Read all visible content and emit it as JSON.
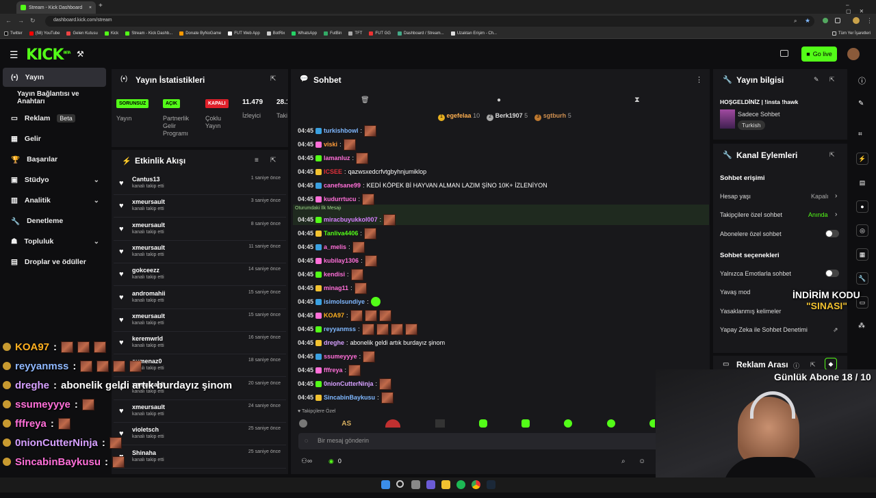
{
  "browser": {
    "tabs": [
      {
        "label": "Stream - Kick Dashboard"
      }
    ],
    "url": "dashboard.kick.com/stream",
    "bookmarks": [
      "Twitter",
      "(58) YouTube",
      "Gelen Kutusu",
      "Kick",
      "Stream - Kick Dashb...",
      "Donate ByNoGame",
      "FUT Web App",
      "BotRix",
      "WhatsApp",
      "FutBin",
      "TFT",
      "FUT GG",
      "Dashboard / Stream...",
      "Uzaktan Erişim - Ch..."
    ],
    "all_bookmarks": "Tüm Yer İşaretleri"
  },
  "header": {
    "logo": "KICK",
    "beta": "BETA",
    "go_live": "Go live"
  },
  "sidebar": {
    "items": [
      {
        "label": "Yayın"
      },
      {
        "label": "Yayın Bağlantısı ve Anahtarı"
      },
      {
        "label": "Reklam",
        "badge": "Beta"
      },
      {
        "label": "Gelir"
      },
      {
        "label": "Başarılar"
      },
      {
        "label": "Stüdyo"
      },
      {
        "label": "Analitik"
      },
      {
        "label": "Denetleme"
      },
      {
        "label": "Topluluk"
      },
      {
        "label": "Droplar ve ödüller"
      }
    ]
  },
  "stats": {
    "title": "Yayın İstatistikleri",
    "items": [
      {
        "badge": "SORUNSUZ",
        "label": "Yayın"
      },
      {
        "badge": "AÇIK",
        "label": "Partnerlik Gelir Programı"
      },
      {
        "badge": "KAPALI",
        "label": "Çoklu Yayın"
      },
      {
        "badge": "11.479",
        "label": "İzleyici"
      },
      {
        "badge": "28.1",
        "label": "Taki"
      }
    ]
  },
  "activity": {
    "title": "Etkinlik Akışı",
    "items": [
      {
        "name": "Cantus13",
        "action": "kanalı takip etti",
        "time": "1 saniye önce"
      },
      {
        "name": "xmeursault",
        "action": "kanalı takip etti",
        "time": "3 saniye önce"
      },
      {
        "name": "xmeursault",
        "action": "kanalı takip etti",
        "time": "8 saniye önce"
      },
      {
        "name": "xmeursault",
        "action": "kanalı takip etti",
        "time": "11 saniye önce"
      },
      {
        "name": "gokceezz",
        "action": "kanalı takip etti",
        "time": "14 saniye önce"
      },
      {
        "name": "andromahii",
        "action": "kanalı takip etti",
        "time": "15 saniye önce"
      },
      {
        "name": "xmeursault",
        "action": "kanalı takip etti",
        "time": "15 saniye önce"
      },
      {
        "name": "keremwrld",
        "action": "kanalı takip etti",
        "time": "16 saniye önce"
      },
      {
        "name": "sumenaz0",
        "action": "kanalı takip etti",
        "time": "18 saniye önce"
      },
      {
        "name": "xmeursault",
        "action": "kanalı takip etti",
        "time": "20 saniye önce"
      },
      {
        "name": "xmeursault",
        "action": "kanalı takip etti",
        "time": "24 saniye önce"
      },
      {
        "name": "violetsch",
        "action": "kanalı takip etti",
        "time": "25 saniye önce"
      },
      {
        "name": "Shinaha",
        "action": "kanalı takip etti",
        "time": "25 saniye önce"
      }
    ]
  },
  "chat": {
    "title": "Sohbet",
    "top_gifters": [
      {
        "rank": "1",
        "name": "egefelaa",
        "count": "10"
      },
      {
        "rank": "2",
        "name": "Berk1907",
        "count": "5"
      },
      {
        "rank": "3",
        "name": "sgtburh",
        "count": "5"
      }
    ],
    "first_msg_label": "Oturumdaki İlk Mesajı",
    "messages": [
      {
        "time": "04:45",
        "user": "turkishbowl",
        "color": "#7fb8ff",
        "text": "",
        "emotes": 1
      },
      {
        "time": "04:45",
        "user": "viski",
        "color": "#ff9d3b",
        "text": "",
        "emotes": 1
      },
      {
        "time": "04:45",
        "user": "lamanluz",
        "color": "#ff6fd8",
        "text": "",
        "emotes": 1
      },
      {
        "time": "04:45",
        "user": "ICSEE",
        "color": "#e0303a",
        "text": "qazwsxedcrfvtgbyhnjumiklop",
        "emotes": 0
      },
      {
        "time": "04:45",
        "user": "canefsane99",
        "color": "#ff6fd8",
        "text": "KEDİ KÖPEK Bİ HAYVAN ALMAN LAZIM ŞİNO 10K+ İZLENİYON",
        "emotes": 0
      },
      {
        "time": "04:45",
        "user": "kudurrtucu",
        "color": "#ff6fd8",
        "text": "",
        "emotes": 1
      },
      {
        "time": "04:45",
        "user": "miracbuyukkol007",
        "color": "#d67fff",
        "text": "",
        "emotes": 1
      },
      {
        "time": "04:45",
        "user": "Tanliva4406",
        "color": "#53fc18",
        "text": "",
        "emotes": 1
      },
      {
        "time": "04:45",
        "user": "a_melis",
        "color": "#ff6fd8",
        "text": "",
        "emotes": 1
      },
      {
        "time": "04:45",
        "user": "kubilay1306",
        "color": "#ff6fd8",
        "text": "",
        "emotes": 1
      },
      {
        "time": "04:45",
        "user": "kendisi",
        "color": "#ff6fd8",
        "text": "",
        "emotes": 1
      },
      {
        "time": "04:45",
        "user": "minag11",
        "color": "#ff6fd8",
        "text": "",
        "emotes": 1
      },
      {
        "time": "04:45",
        "user": "isimolsundiye",
        "color": "#7fb8ff",
        "text": "",
        "emotes": 0
      },
      {
        "time": "04:45",
        "user": "KOA97",
        "color": "#ffb020",
        "text": "",
        "emotes": 3
      },
      {
        "time": "04:45",
        "user": "reyyanmss",
        "color": "#7fb8ff",
        "text": "",
        "emotes": 4
      },
      {
        "time": "04:45",
        "user": "dreghe",
        "color": "#d6a0ff",
        "text": "abonelik geldi artık burdayız şinom",
        "emotes": 0
      },
      {
        "time": "04:45",
        "user": "ssumeyyye",
        "color": "#ff6fd8",
        "text": "",
        "emotes": 1
      },
      {
        "time": "04:45",
        "user": "fffreya",
        "color": "#ff6fd8",
        "text": "",
        "emotes": 1
      },
      {
        "time": "04:45",
        "user": "0nionCutterNinja",
        "color": "#d6a0ff",
        "text": "",
        "emotes": 1
      },
      {
        "time": "04:45",
        "user": "SincabinBaykusu",
        "color": "#7fb8ff",
        "text": "",
        "emotes": 1
      }
    ],
    "followers_only": "Takipçilere Özel",
    "input_placeholder": "Bir mesaj gönderin",
    "count": "0"
  },
  "overlay_chat": [
    {
      "user": "KOA97",
      "color": "#ffb020",
      "text": "",
      "emotes": 3
    },
    {
      "user": "reyyanmss",
      "color": "#8fb8ff",
      "text": "",
      "emotes": 4
    },
    {
      "user": "dreghe",
      "color": "#d6a0ff",
      "text": "abonelik geldi artık burdayız şinom",
      "emotes": 0
    },
    {
      "user": "ssumeyyye",
      "color": "#ff6fd8",
      "text": "",
      "emotes": 1
    },
    {
      "user": "fffreya",
      "color": "#ff6fd8",
      "text": "",
      "emotes": 1
    },
    {
      "user": "0nionCutterNinja",
      "color": "#d6a0ff",
      "text": "",
      "emotes": 1
    },
    {
      "user": "SincabinBaykusu",
      "color": "#ff6fd8",
      "text": "",
      "emotes": 1
    }
  ],
  "stream_info": {
    "title": "Yayın bilgisi",
    "stream_title": "HOŞGELDİNİZ | !insta !hawk",
    "category": "Sadece Sohbet",
    "tag": "Turkish"
  },
  "channel_actions": {
    "title": "Kanal Eylemleri",
    "chat_access": "Sohbet erişimi",
    "account_age": "Hesap yaşı",
    "account_age_value": "Kapalı",
    "followers_chat": "Takipçilere özel sohbet",
    "followers_chat_value": "Anında",
    "subs_chat": "Abonelere özel sohbet",
    "chat_options": "Sohbet seçenekleri",
    "emote_only": "Yalnızca Emotlarla sohbet",
    "slow_mode": "Yavaş mod",
    "banned_words": "Yasaklanmış kelimeler",
    "ai_moderation": "Yapay Zeka ile Sohbet Denetimi"
  },
  "ad_break": {
    "title": "Reklam Arası"
  },
  "overlay": {
    "discount_line1": "İNDİRİM KODU",
    "discount_line2": "\"SINASI\"",
    "daily_subs": "Günlük Abone 18 / 10"
  }
}
